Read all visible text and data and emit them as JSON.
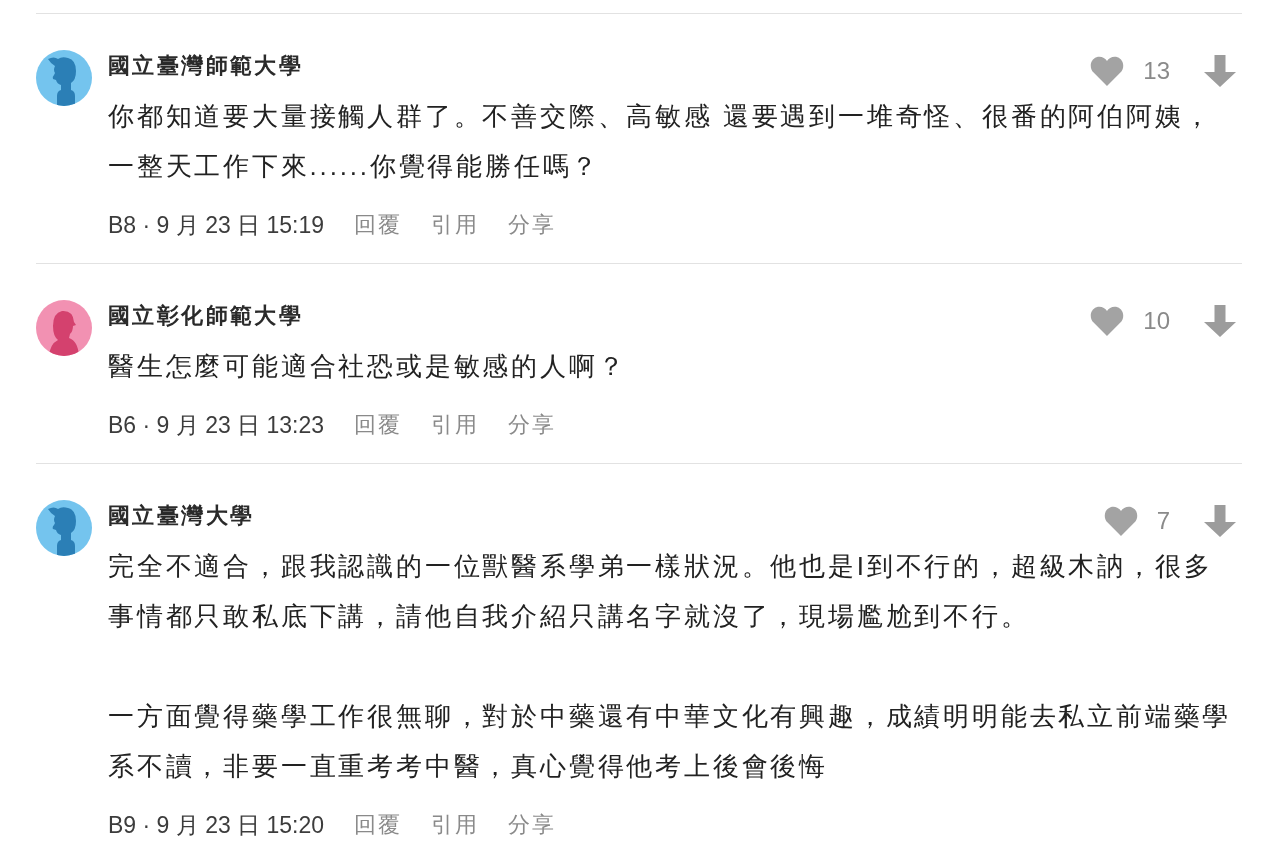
{
  "comments": [
    {
      "author": "國立臺灣師範大學",
      "avatar": {
        "kind": "male"
      },
      "likes": "13",
      "body": [
        "你都知道要大量接觸人群了。不善交際、高敏感 還要遇到一堆奇怪、很番的阿伯阿姨，一整天工作下來......你覺得能勝任嗎？"
      ],
      "meta": "B8 · 9 月 23 日 15:19",
      "actions": [
        "回覆",
        "引用",
        "分享"
      ]
    },
    {
      "author": "國立彰化師範大學",
      "avatar": {
        "kind": "female"
      },
      "likes": "10",
      "body": [
        "醫生怎麼可能適合社恐或是敏感的人啊？"
      ],
      "meta": "B6 · 9 月 23 日 13:23",
      "actions": [
        "回覆",
        "引用",
        "分享"
      ]
    },
    {
      "author": "國立臺灣大學",
      "avatar": {
        "kind": "male"
      },
      "likes": "7",
      "body": [
        "完全不適合，跟我認識的一位獸醫系學弟一樣狀況。他也是I到不行的，超級木訥，很多事情都只敢私底下講，請他自我介紹只講名字就沒了，現場尷尬到不行。",
        "一方面覺得藥學工作很無聊，對於中藥還有中華文化有興趣，成績明明能去私立前端藥學系不讀，非要一直重考考中醫，真心覺得他考上後會後悔"
      ],
      "meta": "B9 · 9 月 23 日 15:20",
      "actions": [
        "回覆",
        "引用",
        "分享"
      ]
    }
  ]
}
